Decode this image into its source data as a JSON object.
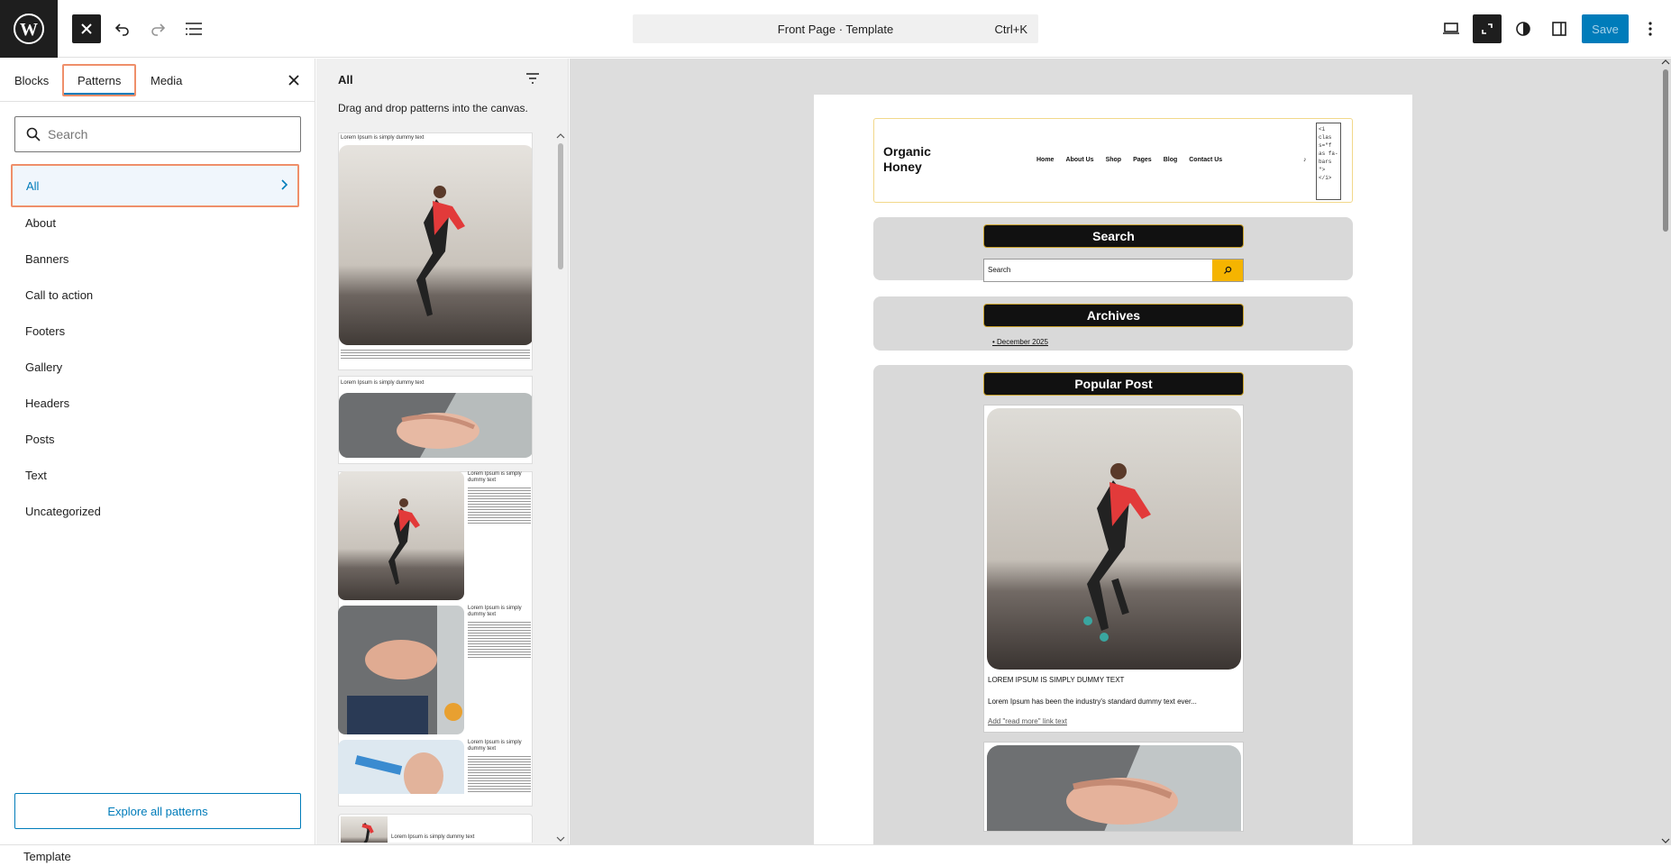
{
  "toolbar": {
    "command_title": "Front Page · Template",
    "command_shortcut": "Ctrl+K",
    "save_label": "Save",
    "accent": "#007cba"
  },
  "inserter": {
    "tabs": [
      "Blocks",
      "Patterns",
      "Media"
    ],
    "active_tab": "Patterns",
    "search_placeholder": "Search",
    "categories": [
      "All",
      "About",
      "Banners",
      "Call to action",
      "Footers",
      "Gallery",
      "Headers",
      "Posts",
      "Text",
      "Uncategorized"
    ],
    "selected_category": "All",
    "explore_label": "Explore all patterns"
  },
  "pattern_panel": {
    "title": "All",
    "hint": "Drag and drop patterns into the canvas.",
    "previews": [
      {
        "caption": "Lorem Ipsum is simply dummy text"
      },
      {
        "caption": "Lorem Ipsum is simply dummy text"
      },
      {
        "caption": "Lorem Ipsum is simply dummy text"
      },
      {
        "caption": "Lorem Ipsum is simply dummy text"
      },
      {
        "caption": "Lorem Ipsum is simply dummy text"
      },
      {
        "caption": "Lorem Ipsum is simply dummy text"
      }
    ]
  },
  "canvas": {
    "site_title": "Organic Honey",
    "nav": [
      "Home",
      "About Us",
      "Shop",
      "Pages",
      "Blog",
      "Contact Us"
    ],
    "code_snippet": "<i clas s=\"f as fa- bars \"> </i>",
    "search_title": "Search",
    "search_input_label": "Search",
    "archives_title": "Archives",
    "archive_item": "December 2025",
    "popular_title": "Popular Post",
    "post_title": "LOREM IPSUM IS SIMPLY DUMMY TEXT",
    "post_excerpt": "Lorem Ipsum has been the industry's standard dummy text ever...",
    "post_more": "Add \"read more\" link text",
    "header_border": "#f2d88a",
    "search_button_color": "#f5b400"
  },
  "footer": {
    "label": "Template"
  }
}
